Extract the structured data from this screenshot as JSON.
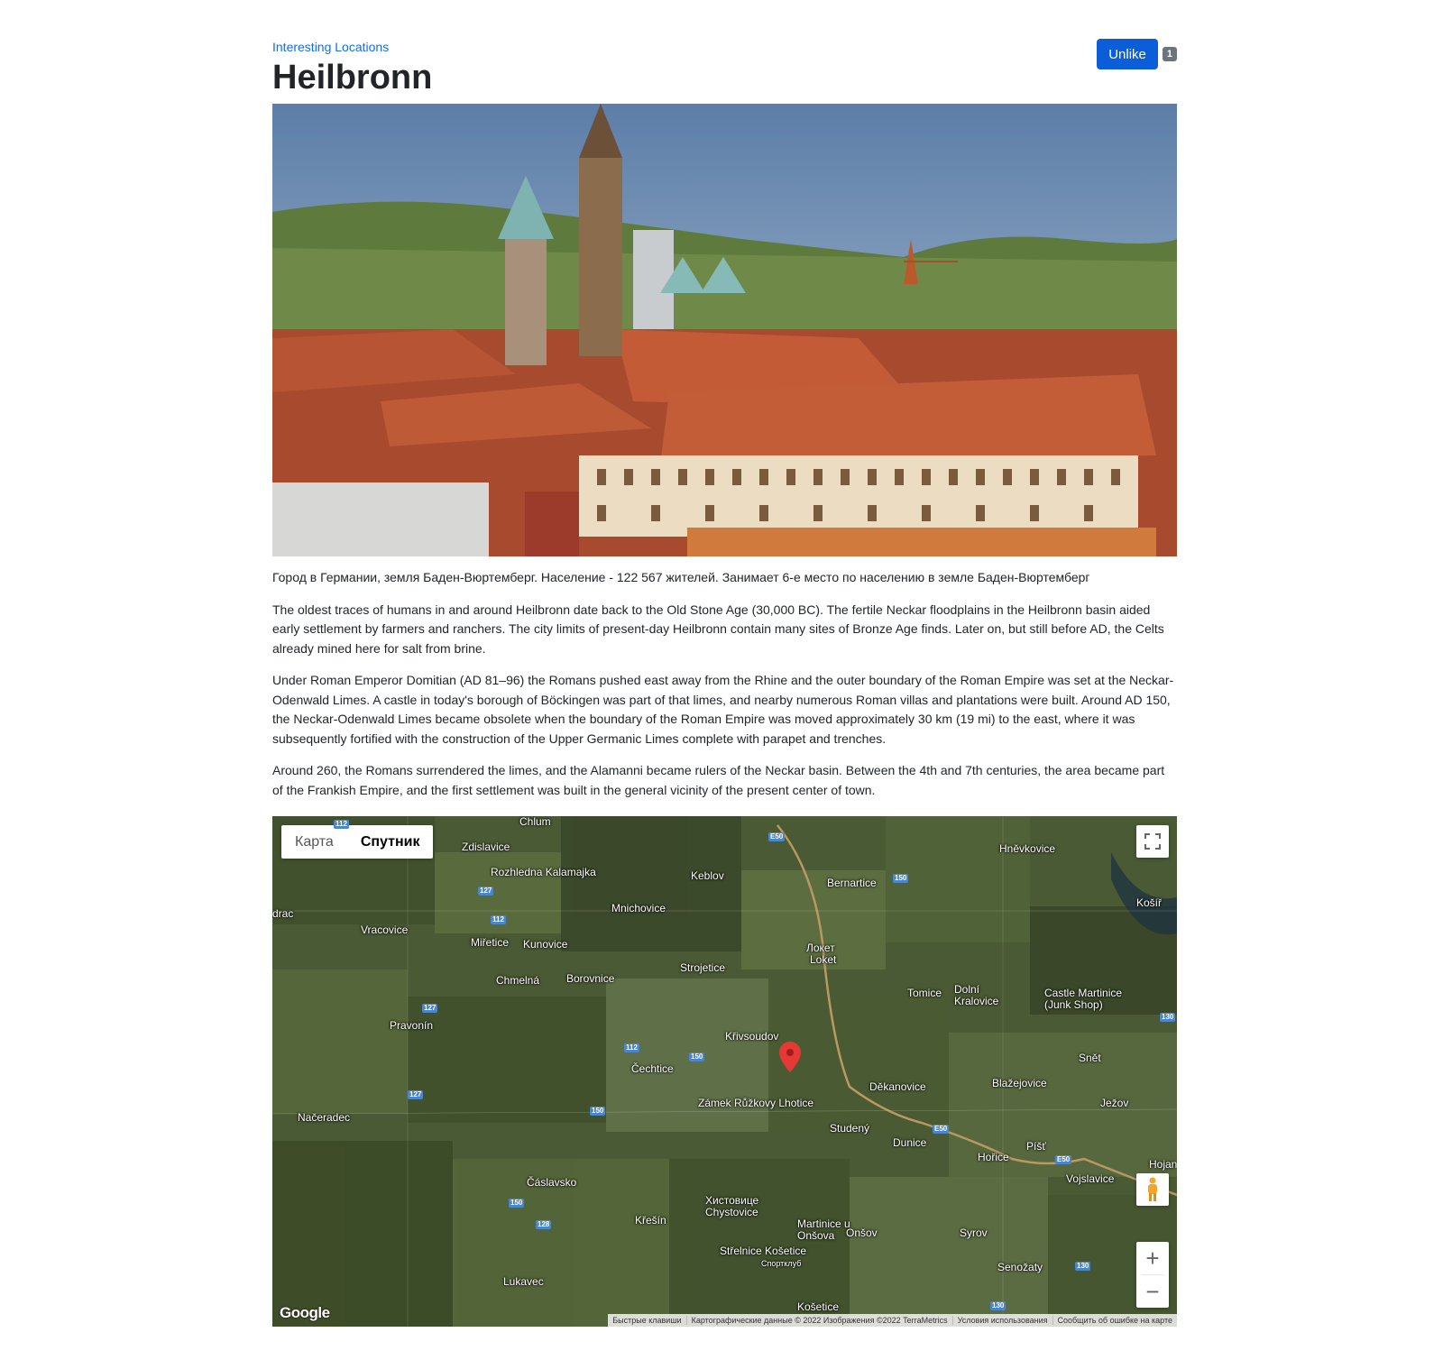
{
  "breadcrumb": "Interesting Locations",
  "page_title": "Heilbronn",
  "like": {
    "button_label": "Unlike",
    "count": "1"
  },
  "paragraphs": [
    "Город в Германии, земля Баден-Вюртемберг. Население - 122 567 жителей. Занимает 6-е место по населению в земле Баден-Вюртемберг",
    "The oldest traces of humans in and around Heilbronn date back to the Old Stone Age (30,000 BC). The fertile Neckar floodplains in the Heilbronn basin aided early settlement by farmers and ranchers. The city limits of present-day Heilbronn contain many sites of Bronze Age finds. Later on, but still before AD, the Celts already mined here for salt from brine.",
    "Under Roman Emperor Domitian (AD 81–96) the Romans pushed east away from the Rhine and the outer boundary of the Roman Empire was set at the Neckar-Odenwald Limes. A castle in today's borough of Böckingen was part of that limes, and nearby numerous Roman villas and plantations were built. Around AD 150, the Neckar-Odenwald Limes became obsolete when the boundary of the Roman Empire was moved approximately 30 km (19 mi) to the east, where it was subsequently fortified with the construction of the Upper Germanic Limes complete with parapet and trenches.",
    "Around 260, the Romans surrendered the limes, and the Alamanni became rulers of the Neckar basin. Between the 4th and 7th centuries, the area became part of the Frankish Empire, and the first settlement was built in the general vicinity of the present center of town."
  ],
  "map": {
    "type_tabs": [
      "Карта",
      "Спутник"
    ],
    "active_tab": "Спутник",
    "icons": [
      "fullscreen-icon",
      "pegman-icon",
      "zoom-in-icon",
      "zoom-out-icon",
      "marker-icon"
    ],
    "zoom_in": "+",
    "zoom_out": "−",
    "google_logo": "Google",
    "place_labels": [
      "Chlum",
      "Zdislavice",
      "Rozhledna Kalamajka",
      "Keblov",
      "Bernartice",
      "Hněvkovice",
      "Košíř",
      "drac",
      "Mnichovice",
      "Vracovice",
      "Miřetice",
      "Kunovice",
      "Локет",
      "Loket",
      "Strojetice",
      "Chmelná",
      "Borovnice",
      "Tomice",
      "Dolní Kralovice",
      "Castle Martinice (Junk Shop)",
      "Pravonín",
      "Křivsoudov",
      "Čechtice",
      "Snět",
      "Děkanovice",
      "Blažejovice",
      "Zámek Růžkovy Lhotice",
      "Ježov",
      "Načeradec",
      "Studený",
      "Dunice",
      "Píšť",
      "Hořice",
      "Hojan",
      "Vojslavice",
      "Čáslavsko",
      "Хистовице Chystovice",
      "Křešín",
      "Martinice u Onšova",
      "Onšov",
      "Syrov",
      "Střelnice Košetice",
      "Спортклуб",
      "Senožaty",
      "Lukavec",
      "Košetice"
    ],
    "road_shields": [
      "112",
      "E50",
      "127",
      "112",
      "150",
      "127",
      "130",
      "112",
      "150",
      "127",
      "150",
      "E50",
      "E50",
      "150",
      "128",
      "130",
      "130"
    ],
    "footer_links": [
      "Быстрые клавиши",
      "Картографические данные © 2022 Изображения ©2022 TerraMetrics",
      "Условия использования",
      "Сообщить об ошибке на карте"
    ]
  },
  "colors": {
    "link": "#0d6efd",
    "button": "#0b5ed7",
    "badge": "#6c757d",
    "marker": "#e53935"
  }
}
